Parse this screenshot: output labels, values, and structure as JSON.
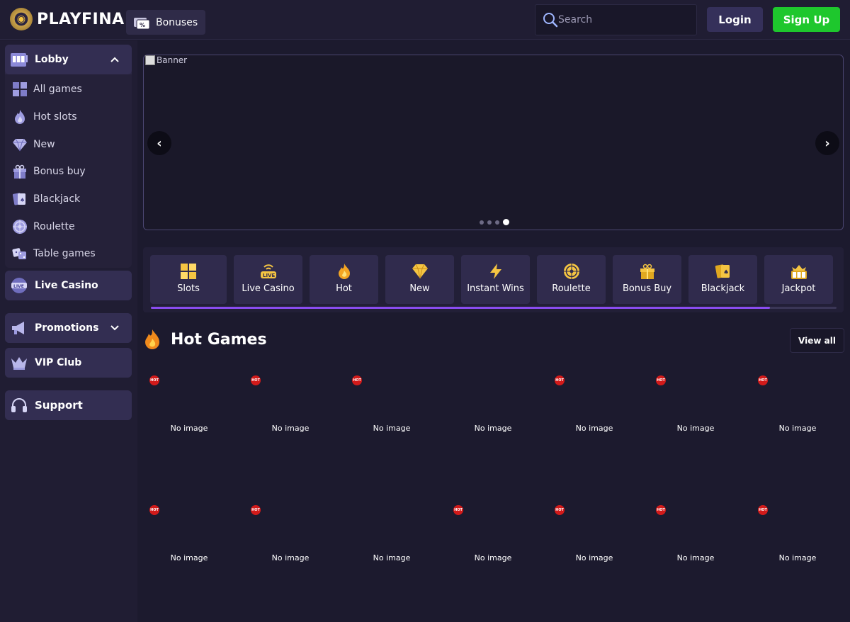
{
  "header": {
    "logo_text": "PLAYFINA",
    "bonuses_label": "Bonuses",
    "search_placeholder": "Search",
    "login_label": "Login",
    "signup_label": "Sign Up"
  },
  "colors": {
    "background": "#1c1a2e",
    "header": "#201d33",
    "signup_green": "#1ec72d",
    "accent_purple": "#8a4cf0",
    "hot_badge_red": "#d21a1a"
  },
  "sidebar": {
    "lobby": {
      "label": "Lobby",
      "icon": "slot-machine-icon",
      "expanded": true,
      "items": [
        {
          "label": "All games",
          "icon": "grid-icon"
        },
        {
          "label": "Hot slots",
          "icon": "flame-icon"
        },
        {
          "label": "New",
          "icon": "diamond-icon"
        },
        {
          "label": "Bonus buy",
          "icon": "gift-icon"
        },
        {
          "label": "Blackjack",
          "icon": "cards-icon"
        },
        {
          "label": "Roulette",
          "icon": "roulette-icon"
        },
        {
          "label": "Table games",
          "icon": "dice-icon"
        }
      ]
    },
    "live_casino": {
      "label": "Live Casino",
      "icon": "live-icon"
    },
    "promotions": {
      "label": "Promotions",
      "icon": "megaphone-icon"
    },
    "vip_club": {
      "label": "VIP Club",
      "icon": "crown-icon"
    },
    "support": {
      "label": "Support",
      "icon": "headset-icon"
    }
  },
  "banner": {
    "alt_text": "Banner",
    "slide_count": 4,
    "active_slide": 4
  },
  "categories": [
    {
      "label": "Slots",
      "icon": "grid-icon"
    },
    {
      "label": "Live Casino",
      "icon": "live-icon"
    },
    {
      "label": "Hot",
      "icon": "flame-icon"
    },
    {
      "label": "New",
      "icon": "diamond-icon"
    },
    {
      "label": "Instant Wins",
      "icon": "lightning-icon"
    },
    {
      "label": "Roulette",
      "icon": "roulette-icon"
    },
    {
      "label": "Bonus Buy",
      "icon": "gift-icon"
    },
    {
      "label": "Blackjack",
      "icon": "cards-icon"
    },
    {
      "label": "Jackpot",
      "icon": "slot-machine-icon"
    }
  ],
  "hot_games": {
    "title": "Hot Games",
    "view_all_label": "View all",
    "badge_text": "HOT",
    "placeholder_text": "No image",
    "rows": [
      [
        true,
        true,
        true,
        false,
        true,
        true,
        true
      ],
      [
        true,
        true,
        false,
        true,
        true,
        true,
        true
      ]
    ]
  }
}
